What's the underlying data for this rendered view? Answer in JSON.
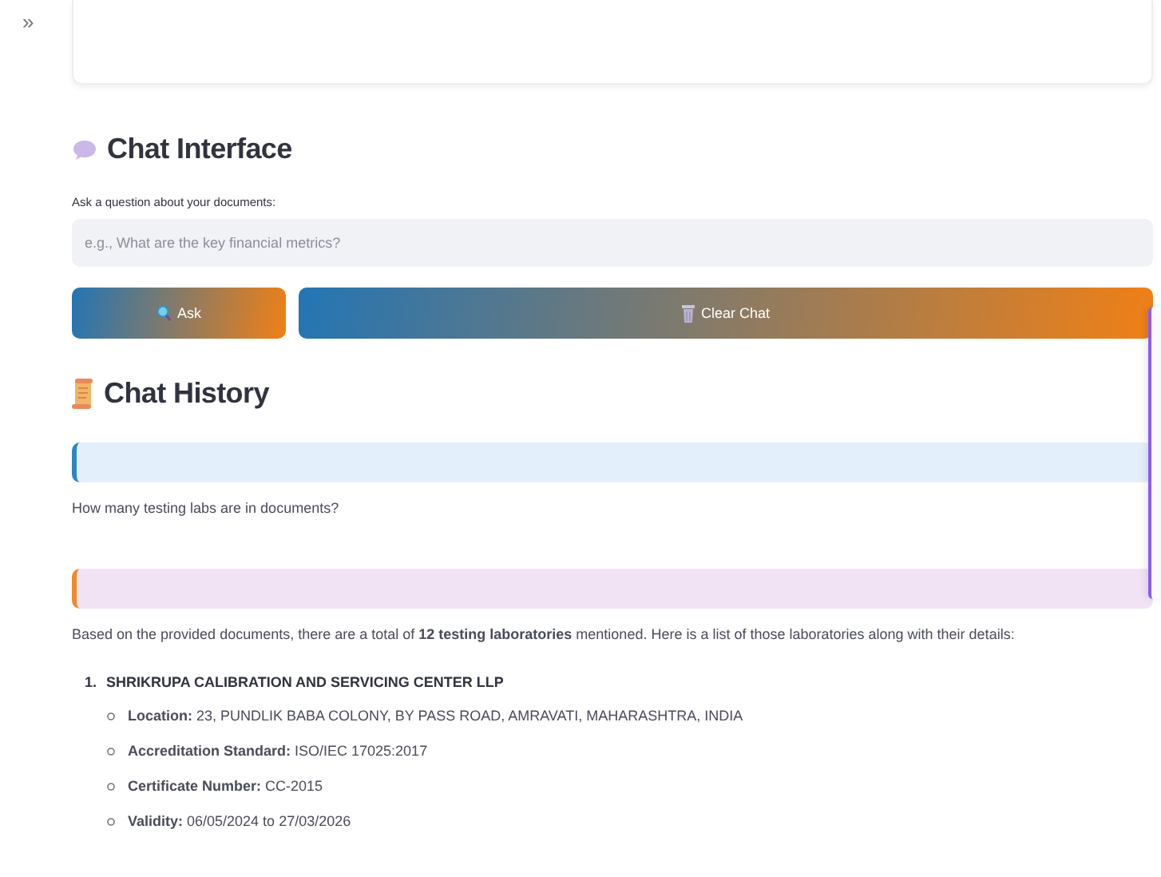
{
  "sidebar_toggle": "»",
  "chat_interface": {
    "title": "Chat Interface",
    "question_label": "Ask a question about your documents:",
    "question_field": {
      "placeholder": "e.g., What are the key financial metrics?"
    },
    "buttons": [
      {
        "kind": "ask",
        "label": "Ask"
      },
      {
        "kind": "clear",
        "label": "Clear Chat"
      }
    ]
  },
  "chat_history": {
    "title": "Chat History",
    "messages": [
      {
        "kind": "user",
        "text": "How many testing labs are in documents?"
      },
      {
        "kind": "assistant",
        "text": "Based on the provided documents, there are a total of **12 testing laboratories** mentioned. Here is a list of those laboratories along with their details:",
        "list": [
          {
            "number": "1.",
            "name": "SHRIKRUPA CALIBRATION AND SERVICING CENTER LLP",
            "details": [
              "**Location:** 23, PUNDLIK BABA COLONY, BY PASS ROAD, AMRAVATI, MAHARASHTRA, INDIA",
              "**Accreditation Standard:** ISO/IEC 17025:2017",
              "**Certificate Number:** CC-2015",
              "**Validity:** 06/05/2024 to 27/03/2026"
            ]
          }
        ]
      }
    ]
  }
}
